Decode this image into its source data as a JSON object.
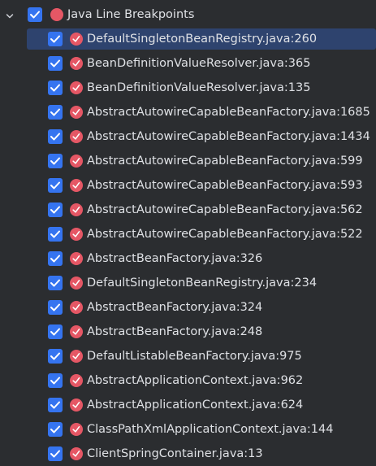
{
  "group": {
    "label": "Java Line Breakpoints",
    "checked": true,
    "expanded": true
  },
  "items": [
    {
      "label": "DefaultSingletonBeanRegistry.java:260",
      "checked": true,
      "selected": true
    },
    {
      "label": "BeanDefinitionValueResolver.java:365",
      "checked": true
    },
    {
      "label": "BeanDefinitionValueResolver.java:135",
      "checked": true
    },
    {
      "label": "AbstractAutowireCapableBeanFactory.java:1685",
      "checked": true
    },
    {
      "label": "AbstractAutowireCapableBeanFactory.java:1434",
      "checked": true
    },
    {
      "label": "AbstractAutowireCapableBeanFactory.java:599",
      "checked": true
    },
    {
      "label": "AbstractAutowireCapableBeanFactory.java:593",
      "checked": true
    },
    {
      "label": "AbstractAutowireCapableBeanFactory.java:562",
      "checked": true
    },
    {
      "label": "AbstractAutowireCapableBeanFactory.java:522",
      "checked": true
    },
    {
      "label": "AbstractBeanFactory.java:326",
      "checked": true
    },
    {
      "label": "DefaultSingletonBeanRegistry.java:234",
      "checked": true
    },
    {
      "label": "AbstractBeanFactory.java:324",
      "checked": true
    },
    {
      "label": "AbstractBeanFactory.java:248",
      "checked": true
    },
    {
      "label": "DefaultListableBeanFactory.java:975",
      "checked": true
    },
    {
      "label": "AbstractApplicationContext.java:962",
      "checked": true
    },
    {
      "label": "AbstractApplicationContext.java:624",
      "checked": true
    },
    {
      "label": "ClassPathXmlApplicationContext.java:144",
      "checked": true
    },
    {
      "label": "ClientSpringContainer.java:13",
      "checked": true
    }
  ],
  "colors": {
    "background": "#2b2d30",
    "selection": "#2e436e",
    "checkbox": "#3574f0",
    "breakpoint": "#e55765",
    "text": "#dfe1e5"
  },
  "icons": {
    "expand": "chevron-down-icon",
    "group": "breakpoint-group-icon",
    "item": "line-breakpoint-verified-icon"
  }
}
